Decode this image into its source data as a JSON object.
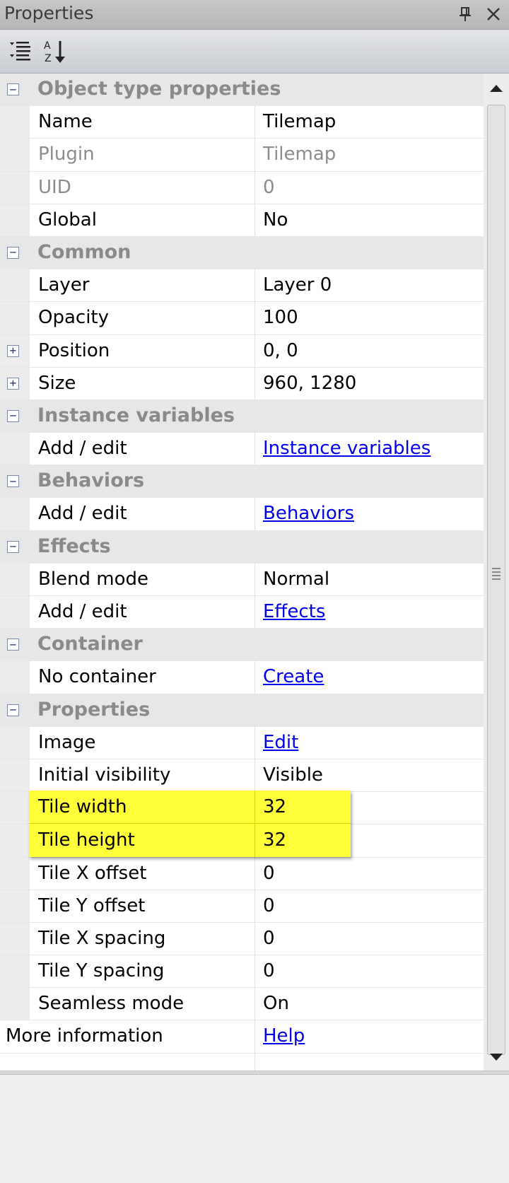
{
  "window": {
    "title": "Properties",
    "pin_icon": "pin-icon",
    "close_icon": "close-icon"
  },
  "toolbar": {
    "categorized_icon": "categorized-view-icon",
    "alphabetical_icon": "sort-az-icon"
  },
  "grid": {
    "rows": [
      {
        "kind": "cat",
        "label": "Object type properties",
        "expander": "⊟"
      },
      {
        "kind": "prop",
        "name": "Name",
        "value": "Tilemap"
      },
      {
        "kind": "prop",
        "name": "Plugin",
        "value": "Tilemap",
        "dim": true
      },
      {
        "kind": "prop",
        "name": "UID",
        "value": "0",
        "dim": true
      },
      {
        "kind": "prop",
        "name": "Global",
        "value": "No"
      },
      {
        "kind": "cat",
        "label": "Common",
        "expander": "⊟"
      },
      {
        "kind": "prop",
        "name": "Layer",
        "value": "Layer 0"
      },
      {
        "kind": "prop",
        "name": "Opacity",
        "value": "100"
      },
      {
        "kind": "prop",
        "name": "Position",
        "value": "0, 0",
        "expander": "⊞"
      },
      {
        "kind": "prop",
        "name": "Size",
        "value": "960, 1280",
        "expander": "⊞"
      },
      {
        "kind": "cat",
        "label": "Instance variables",
        "expander": "⊟"
      },
      {
        "kind": "prop",
        "name": "Add / edit",
        "value": "Instance variables",
        "link": true
      },
      {
        "kind": "cat",
        "label": "Behaviors",
        "expander": "⊟"
      },
      {
        "kind": "prop",
        "name": "Add / edit",
        "value": "Behaviors",
        "link": true
      },
      {
        "kind": "cat",
        "label": "Effects",
        "expander": "⊟"
      },
      {
        "kind": "prop",
        "name": "Blend mode",
        "value": "Normal"
      },
      {
        "kind": "prop",
        "name": "Add / edit",
        "value": "Effects",
        "link": true
      },
      {
        "kind": "cat",
        "label": "Container",
        "expander": "⊟"
      },
      {
        "kind": "prop",
        "name": "No container",
        "value": "Create",
        "link": true
      },
      {
        "kind": "cat",
        "label": "Properties",
        "expander": "⊟"
      },
      {
        "kind": "prop",
        "name": "Image",
        "value": "Edit",
        "link": true
      },
      {
        "kind": "prop",
        "name": "Initial visibility",
        "value": "Visible"
      },
      {
        "kind": "prop",
        "name": "Tile width",
        "value": "32",
        "highlight": true
      },
      {
        "kind": "prop",
        "name": "Tile height",
        "value": "32",
        "highlight": true
      },
      {
        "kind": "prop",
        "name": "Tile X offset",
        "value": "0"
      },
      {
        "kind": "prop",
        "name": "Tile Y offset",
        "value": "0"
      },
      {
        "kind": "prop",
        "name": "Tile X spacing",
        "value": "0"
      },
      {
        "kind": "prop",
        "name": "Tile Y spacing",
        "value": "0"
      },
      {
        "kind": "prop",
        "name": "Seamless mode",
        "value": "On"
      },
      {
        "kind": "root",
        "name": "More information",
        "value": "Help",
        "link": true
      },
      {
        "kind": "root",
        "name": "",
        "value": ""
      }
    ]
  },
  "highlight": {
    "tile_width_label": "Tile width",
    "tile_width_value": "32",
    "tile_height_label": "Tile height",
    "tile_height_value": "32",
    "color": "#ffff3a"
  },
  "colors": {
    "link": "#0000ee",
    "category_text": "#8a8a8a",
    "category_bg": "#e7e7e7"
  }
}
